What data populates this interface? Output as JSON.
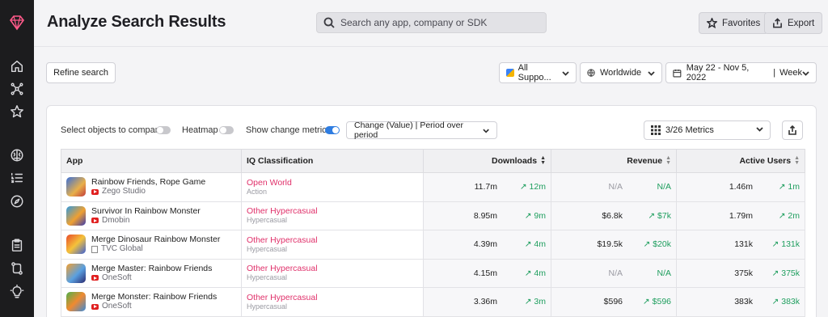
{
  "header": {
    "title": "Analyze Search Results",
    "search_placeholder": "Search any app, company or SDK",
    "favorites_label": "Favorites",
    "export_label": "Export"
  },
  "sidebar": {
    "icons": [
      "home-icon",
      "network-icon",
      "star-icon",
      "brain-icon",
      "list-icon",
      "compass-icon",
      "clipboard-icon",
      "git-compare-icon",
      "lightbulb-icon"
    ]
  },
  "filters": {
    "refine_label": "Refine search",
    "store_value": "All Suppo...",
    "region_value": "Worldwide",
    "date_value": "May 22 - Nov 5, 2022",
    "granularity_value": "Week"
  },
  "controls": {
    "compare_label": "Select objects to compare",
    "compare_on": false,
    "heatmap_label": "Heatmap",
    "heatmap_on": false,
    "change_label": "Show change metrics",
    "change_on": true,
    "period_value": "Change (Value) | Period over period",
    "metrics_value": "3/26 Metrics"
  },
  "table": {
    "columns": [
      "App",
      "IQ Classification",
      "Downloads",
      "Revenue",
      "Active Users"
    ],
    "rows": [
      {
        "name": "Rainbow Friends, Rope Game",
        "publisher": "Zego Studio",
        "pub_icon": "youtube-icon",
        "iq": "Open World",
        "iq_sub": "Action",
        "downloads": "11.7m",
        "downloads_change": "12m",
        "revenue": "N/A",
        "revenue_change": "N/A",
        "active": "1.46m",
        "active_change": "1m"
      },
      {
        "name": "Survivor In Rainbow Monster",
        "publisher": "Dmobin",
        "pub_icon": "youtube-icon",
        "iq": "Other Hypercasual",
        "iq_sub": "Hypercasual",
        "downloads": "8.95m",
        "downloads_change": "9m",
        "revenue": "$6.8k",
        "revenue_change": "$7k",
        "active": "1.79m",
        "active_change": "2m"
      },
      {
        "name": "Merge Dinosaur Rainbow Monster",
        "publisher": "TVC Global",
        "pub_icon": "building-icon",
        "iq": "Other Hypercasual",
        "iq_sub": "Hypercasual",
        "downloads": "4.39m",
        "downloads_change": "4m",
        "revenue": "$19.5k",
        "revenue_change": "$20k",
        "active": "131k",
        "active_change": "131k"
      },
      {
        "name": "Merge Master: Rainbow Friends",
        "publisher": "OneSoft",
        "pub_icon": "youtube-icon",
        "iq": "Other Hypercasual",
        "iq_sub": "Hypercasual",
        "downloads": "4.15m",
        "downloads_change": "4m",
        "revenue": "N/A",
        "revenue_change": "N/A",
        "active": "375k",
        "active_change": "375k"
      },
      {
        "name": "Merge Monster: Rainbow Friends",
        "publisher": "OneSoft",
        "pub_icon": "youtube-icon",
        "iq": "Other Hypercasual",
        "iq_sub": "Hypercasual",
        "downloads": "3.36m",
        "downloads_change": "3m",
        "revenue": "$596",
        "revenue_change": "$596",
        "active": "383k",
        "active_change": "383k"
      }
    ]
  },
  "colors": {
    "sidebar": "#1c1c1e",
    "iq_pink": "#e0306a",
    "positive_green": "#1e9e5e",
    "toggle_on": "#2f7de1"
  }
}
